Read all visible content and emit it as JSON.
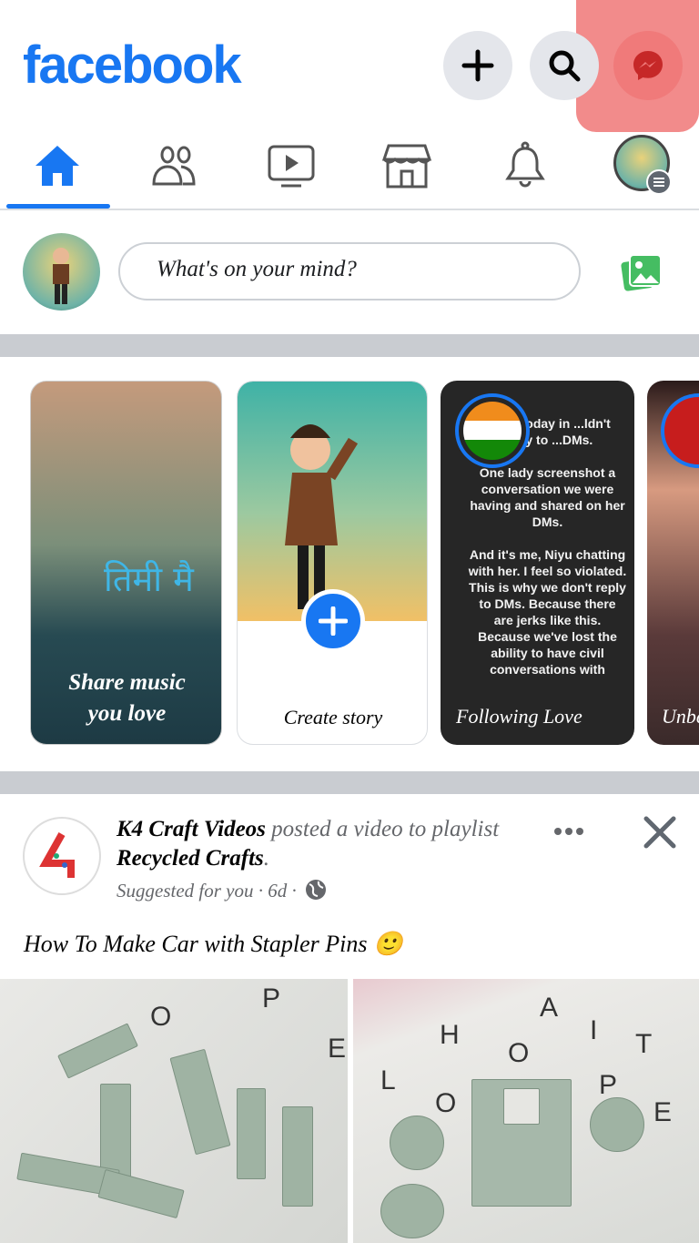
{
  "header": {
    "logo": "facebook",
    "buttons": [
      {
        "icon": "plus-icon"
      },
      {
        "icon": "search-icon"
      },
      {
        "icon": "messenger-icon",
        "highlighted": true
      }
    ]
  },
  "nav": {
    "tabs": [
      {
        "icon": "home-icon",
        "active": true
      },
      {
        "icon": "friends-icon"
      },
      {
        "icon": "watch-icon"
      },
      {
        "icon": "marketplace-icon"
      },
      {
        "icon": "notifications-icon"
      },
      {
        "icon": "profile-menu-icon"
      }
    ]
  },
  "composer": {
    "placeholder": "What's on your mind?",
    "photo_icon": "photo-icon"
  },
  "stories": [
    {
      "label": "Share music you love",
      "overlay": "तिमी मै"
    },
    {
      "label": "Create story"
    },
    {
      "label": "Following Love",
      "text": "...son today in ...ldn't reply to ...DMs.\n\nOne lady screenshot a conversation we were having and shared on her DMs.\n\nAnd it's me, Niyu chatting with her. I feel so violated. This is why we don't reply to DMs. Because there are jerks like this. Because we've lost the ability to have civil conversations with"
    },
    {
      "label": "Unbe"
    }
  ],
  "post": {
    "author": "K4 Craft Videos",
    "action": " posted a video to playlist ",
    "playlist": "Recycled Crafts",
    "period": ".",
    "meta": "Suggested for you · 6d ·",
    "caption": "How To Make Car with Stapler Pins 🙂",
    "colors": {
      "accent": "#1877f2",
      "highlight": "#f28b8b"
    }
  }
}
